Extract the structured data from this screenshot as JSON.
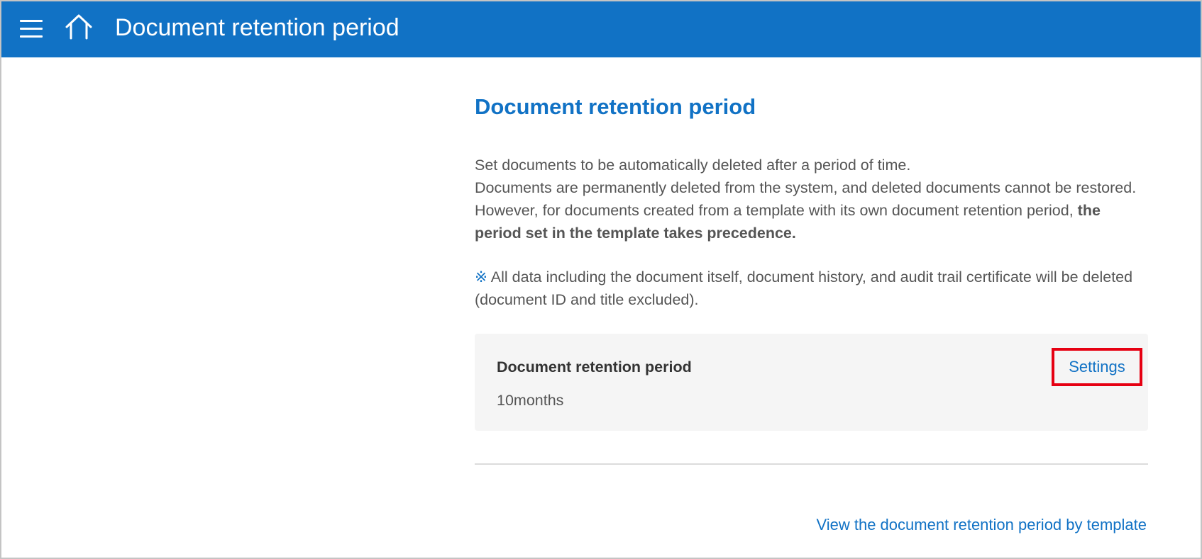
{
  "header": {
    "title": "Document retention period",
    "menu_icon": "hamburger-menu-icon",
    "home_icon": "home-icon",
    "bar_color": "#1172c5"
  },
  "main": {
    "title": "Document retention period",
    "description": [
      "Set documents to be automatically deleted after a period of time.",
      "Documents are permanently deleted from the system, and deleted documents cannot be restored."
    ],
    "description_precedence_prefix": "However, for documents created from a template with its own document retention period, ",
    "description_precedence_bold": "the period set in the template takes precedence.",
    "note_mark": "※",
    "note_text": " All data including the document itself, document history, and audit trail certificate will be deleted (document ID and title excluded).",
    "card": {
      "label": "Document retention period",
      "value": "10months",
      "settings_label": "Settings",
      "highlight_color": "#e60012"
    },
    "template_link": "View the document retention period by template"
  }
}
